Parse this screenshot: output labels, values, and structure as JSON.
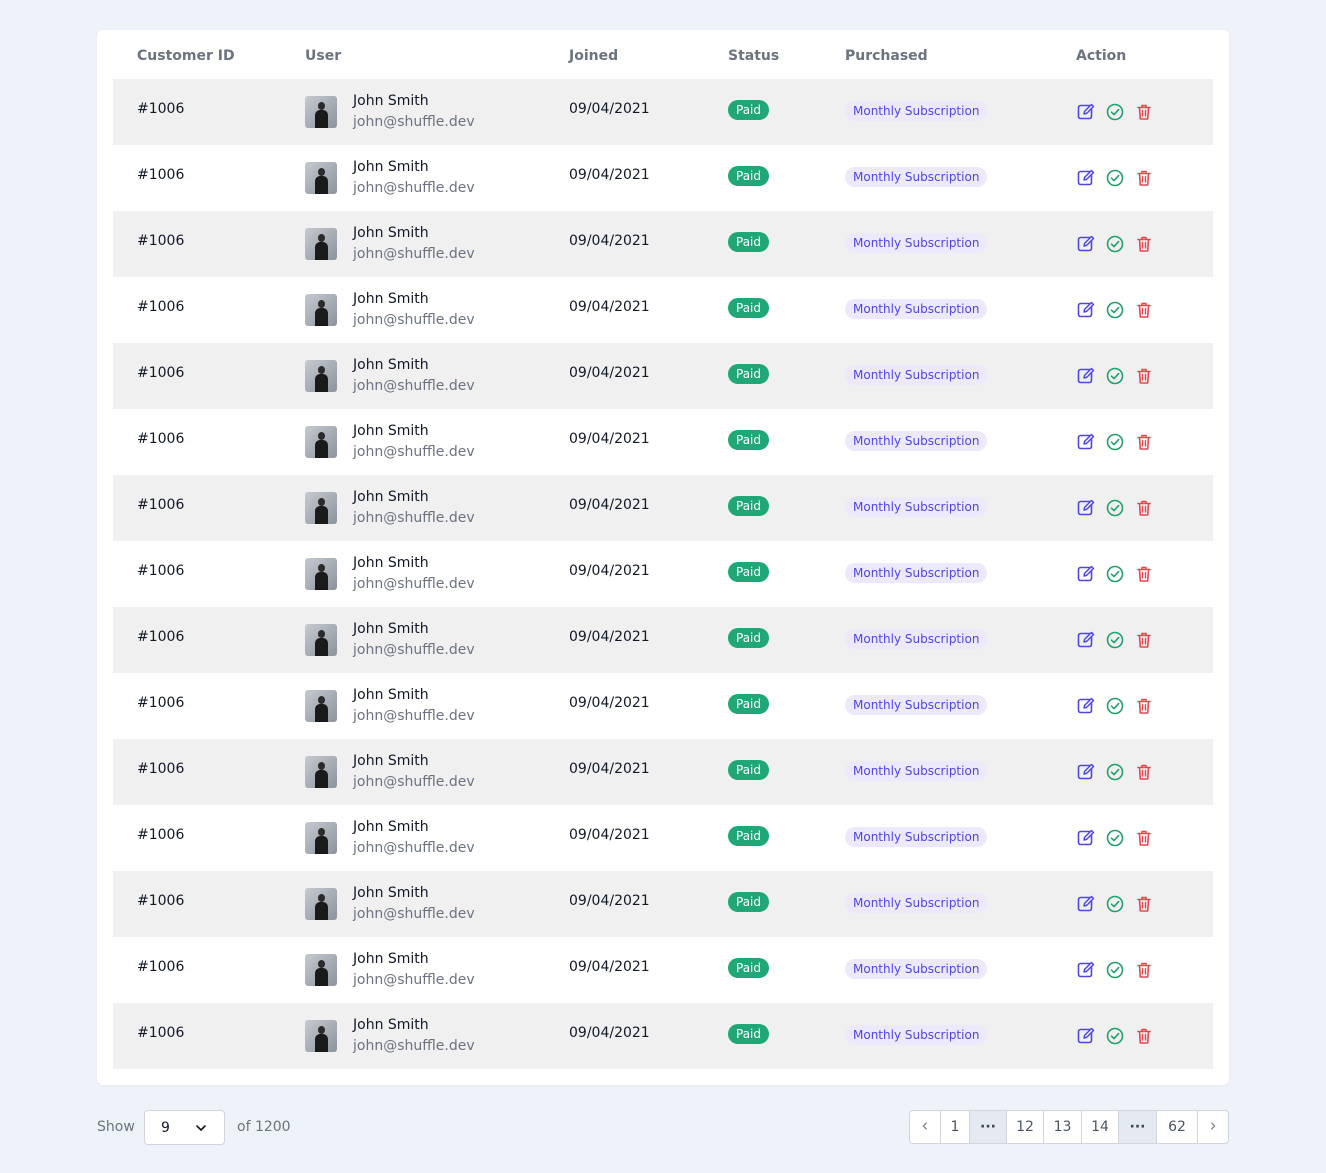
{
  "table": {
    "headers": {
      "customer_id": "Customer ID",
      "user": "User",
      "joined": "Joined",
      "status": "Status",
      "purchased": "Purchased",
      "action": "Action"
    },
    "rows": [
      {
        "customer_id": "#1006",
        "name": "John Smith",
        "email": "john@shuffle.dev",
        "joined": "09/04/2021",
        "status": "Paid",
        "purchased": "Monthly Subscription"
      },
      {
        "customer_id": "#1006",
        "name": "John Smith",
        "email": "john@shuffle.dev",
        "joined": "09/04/2021",
        "status": "Paid",
        "purchased": "Monthly Subscription"
      },
      {
        "customer_id": "#1006",
        "name": "John Smith",
        "email": "john@shuffle.dev",
        "joined": "09/04/2021",
        "status": "Paid",
        "purchased": "Monthly Subscription"
      },
      {
        "customer_id": "#1006",
        "name": "John Smith",
        "email": "john@shuffle.dev",
        "joined": "09/04/2021",
        "status": "Paid",
        "purchased": "Monthly Subscription"
      },
      {
        "customer_id": "#1006",
        "name": "John Smith",
        "email": "john@shuffle.dev",
        "joined": "09/04/2021",
        "status": "Paid",
        "purchased": "Monthly Subscription"
      },
      {
        "customer_id": "#1006",
        "name": "John Smith",
        "email": "john@shuffle.dev",
        "joined": "09/04/2021",
        "status": "Paid",
        "purchased": "Monthly Subscription"
      },
      {
        "customer_id": "#1006",
        "name": "John Smith",
        "email": "john@shuffle.dev",
        "joined": "09/04/2021",
        "status": "Paid",
        "purchased": "Monthly Subscription"
      },
      {
        "customer_id": "#1006",
        "name": "John Smith",
        "email": "john@shuffle.dev",
        "joined": "09/04/2021",
        "status": "Paid",
        "purchased": "Monthly Subscription"
      },
      {
        "customer_id": "#1006",
        "name": "John Smith",
        "email": "john@shuffle.dev",
        "joined": "09/04/2021",
        "status": "Paid",
        "purchased": "Monthly Subscription"
      },
      {
        "customer_id": "#1006",
        "name": "John Smith",
        "email": "john@shuffle.dev",
        "joined": "09/04/2021",
        "status": "Paid",
        "purchased": "Monthly Subscription"
      },
      {
        "customer_id": "#1006",
        "name": "John Smith",
        "email": "john@shuffle.dev",
        "joined": "09/04/2021",
        "status": "Paid",
        "purchased": "Monthly Subscription"
      },
      {
        "customer_id": "#1006",
        "name": "John Smith",
        "email": "john@shuffle.dev",
        "joined": "09/04/2021",
        "status": "Paid",
        "purchased": "Monthly Subscription"
      },
      {
        "customer_id": "#1006",
        "name": "John Smith",
        "email": "john@shuffle.dev",
        "joined": "09/04/2021",
        "status": "Paid",
        "purchased": "Monthly Subscription"
      },
      {
        "customer_id": "#1006",
        "name": "John Smith",
        "email": "john@shuffle.dev",
        "joined": "09/04/2021",
        "status": "Paid",
        "purchased": "Monthly Subscription"
      },
      {
        "customer_id": "#1006",
        "name": "John Smith",
        "email": "john@shuffle.dev",
        "joined": "09/04/2021",
        "status": "Paid",
        "purchased": "Monthly Subscription"
      }
    ],
    "action_icons": [
      "edit-icon",
      "check-circle-icon",
      "trash-icon"
    ]
  },
  "footer": {
    "show_label": "Show",
    "page_size": "9",
    "of_total": "of 1200",
    "pagination": {
      "prev_icon": "chevron-left-icon",
      "pages": [
        "1",
        "···",
        "12",
        "13",
        "14",
        "···",
        "62"
      ],
      "next_icon": "chevron-right-icon"
    }
  },
  "colors": {
    "background": "#eef2f9",
    "paid_badge": "#1fa775",
    "plan_badge_bg": "#ebe9fb",
    "plan_badge_text": "#4f46e5",
    "edit_icon": "#4f46e5",
    "approve_icon": "#22a06b",
    "delete_icon": "#e5484d",
    "stripe": "#f0f0f0"
  }
}
